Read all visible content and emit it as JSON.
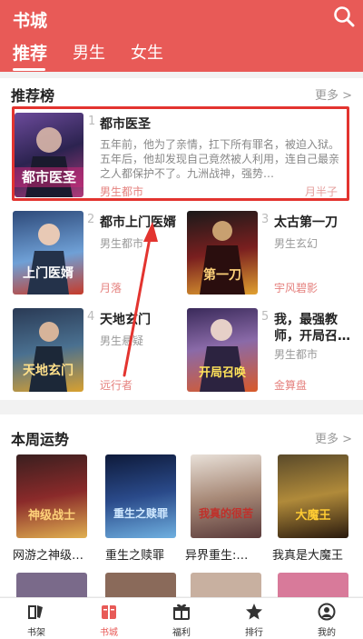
{
  "header": {
    "title": "书城",
    "tabs": [
      "推荐",
      "男生",
      "女生"
    ]
  },
  "recommend": {
    "heading": "推荐榜",
    "more": "更多 >",
    "featured": {
      "rank": "1",
      "title": "都市医圣",
      "desc": "五年前，他为了亲情，扛下所有罪名，被迫入狱。五年后，他却发现自己竟然被人利用，连自己最亲之人都保护不了。九洲战神，强势…",
      "category": "男生都市",
      "author": "月半子",
      "cover_text": "都市医圣"
    },
    "grid": [
      {
        "rank": "2",
        "title": "都市上门医婿",
        "category": "男生都市",
        "author": "月落",
        "cover_text": "上门医婿"
      },
      {
        "rank": "3",
        "title": "太古第一刀",
        "category": "男生玄幻",
        "author": "宇风碧影",
        "cover_text": "第一刀"
      },
      {
        "rank": "4",
        "title": "天地玄门",
        "category": "男生悬疑",
        "author": "远行者",
        "cover_text": "天地玄门"
      },
      {
        "rank": "5",
        "title": "我，最强教师，开局召…",
        "title_line1": "我，最强教",
        "title_line2": "师，开局召…",
        "category": "男生都市",
        "author": "金算盘",
        "cover_text": "开局召唤"
      }
    ]
  },
  "weekly": {
    "heading": "本周运势",
    "more": "更多 >",
    "books": [
      {
        "title": "网游之神级…",
        "cover_text": "神级战士"
      },
      {
        "title": "重生之赎罪",
        "cover_text": "重生之赎罪"
      },
      {
        "title": "异界重生:…",
        "cover_text": "我真的很苦"
      },
      {
        "title": "我真是大魔王",
        "cover_text": "大魔王"
      }
    ]
  },
  "bottom_nav": [
    {
      "label": "书架",
      "icon": "bookshelf-icon"
    },
    {
      "label": "书城",
      "icon": "bookstore-icon"
    },
    {
      "label": "福利",
      "icon": "gift-icon"
    },
    {
      "label": "排行",
      "icon": "ranking-icon"
    },
    {
      "label": "我的",
      "icon": "profile-icon"
    }
  ],
  "colors": {
    "brand": "#e85a57",
    "active_nav": "#e85a57",
    "highlight_box": "#e3342f"
  }
}
